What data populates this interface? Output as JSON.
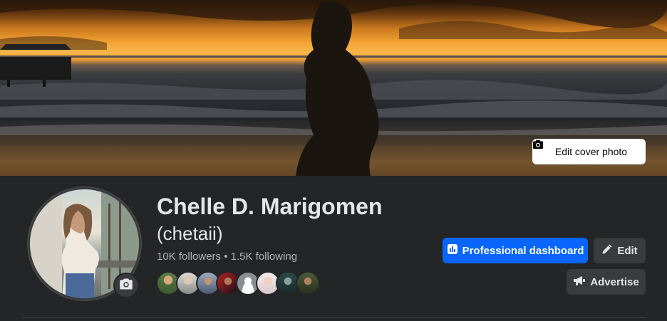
{
  "cover": {
    "edit_button_label": "Edit cover photo",
    "camera_icon": "camera-icon"
  },
  "profile": {
    "name": "Chelle D. Marigomen",
    "alternate_name": "(chetaii)",
    "followers_text": "10K followers",
    "separator": " • ",
    "following_text": "1.5K following",
    "friend_avatar_count": 8
  },
  "actions": {
    "professional_dashboard_label": "Professional dashboard",
    "edit_label": "Edit",
    "advertise_label": "Advertise"
  },
  "colors": {
    "background": "#242526",
    "primary": "#0866ff",
    "secondary_button": "#3a3b3c",
    "text": "#e4e6eb",
    "muted_text": "#b0b3b8"
  }
}
